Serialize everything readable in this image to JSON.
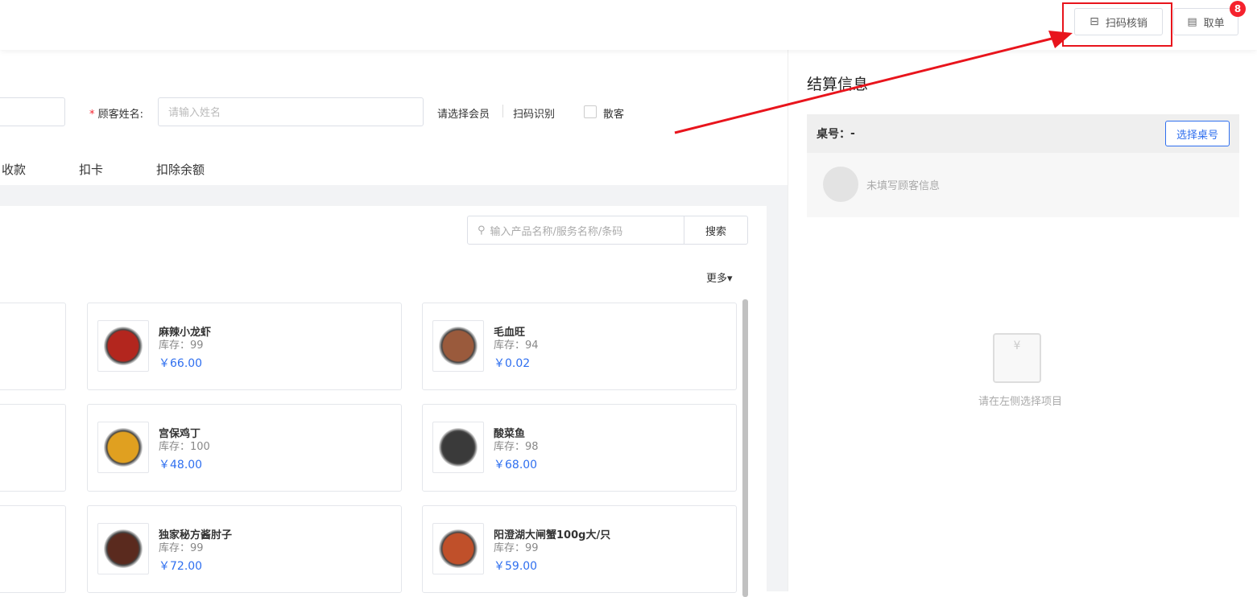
{
  "header": {
    "scan_verify_label": "扫码核销",
    "take_order_label": "取单",
    "take_order_badge": "8"
  },
  "form": {
    "customer_name_label": "顾客姓名",
    "required_mark": "*",
    "customer_name_placeholder": "请输入姓名",
    "select_member": "请选择会员",
    "scan_identify": "扫码识别",
    "walk_in_label": "散客"
  },
  "tabs": [
    "收款",
    "扣卡",
    "扣除余额"
  ],
  "search": {
    "placeholder": "输入产品名称/服务名称/条码",
    "button": "搜索",
    "more": "更多"
  },
  "products": [
    {
      "name": "麻辣小龙虾",
      "stock_label": "库存：",
      "stock": "99",
      "price": "￥66.00",
      "color": "#b3261e"
    },
    {
      "name": "毛血旺",
      "stock_label": "库存：",
      "stock": "94",
      "price": "￥0.02",
      "color": "#9a5a3c"
    },
    {
      "name": "宫保鸡丁",
      "stock_label": "库存：",
      "stock": "100",
      "price": "￥48.00",
      "color": "#e0a020"
    },
    {
      "name": "酸菜鱼",
      "stock_label": "库存：",
      "stock": "98",
      "price": "￥68.00",
      "color": "#3a3a3a"
    },
    {
      "name": "独家秘方酱肘子",
      "stock_label": "库存：",
      "stock": "99",
      "price": "￥72.00",
      "color": "#5a2a1e"
    },
    {
      "name": "阳澄湖大闸蟹100g大/只",
      "stock_label": "库存：",
      "stock": "99",
      "price": "￥59.00",
      "color": "#c0502a"
    }
  ],
  "settlement": {
    "title": "结算信息",
    "table_label": "桌号：",
    "table_value": "-",
    "select_table": "选择桌号",
    "no_customer": "未填写顾客信息",
    "empty_hint": "请在左侧选择项目"
  },
  "colors": {
    "accent": "#2f6fef",
    "annotation": "#e8141c"
  }
}
